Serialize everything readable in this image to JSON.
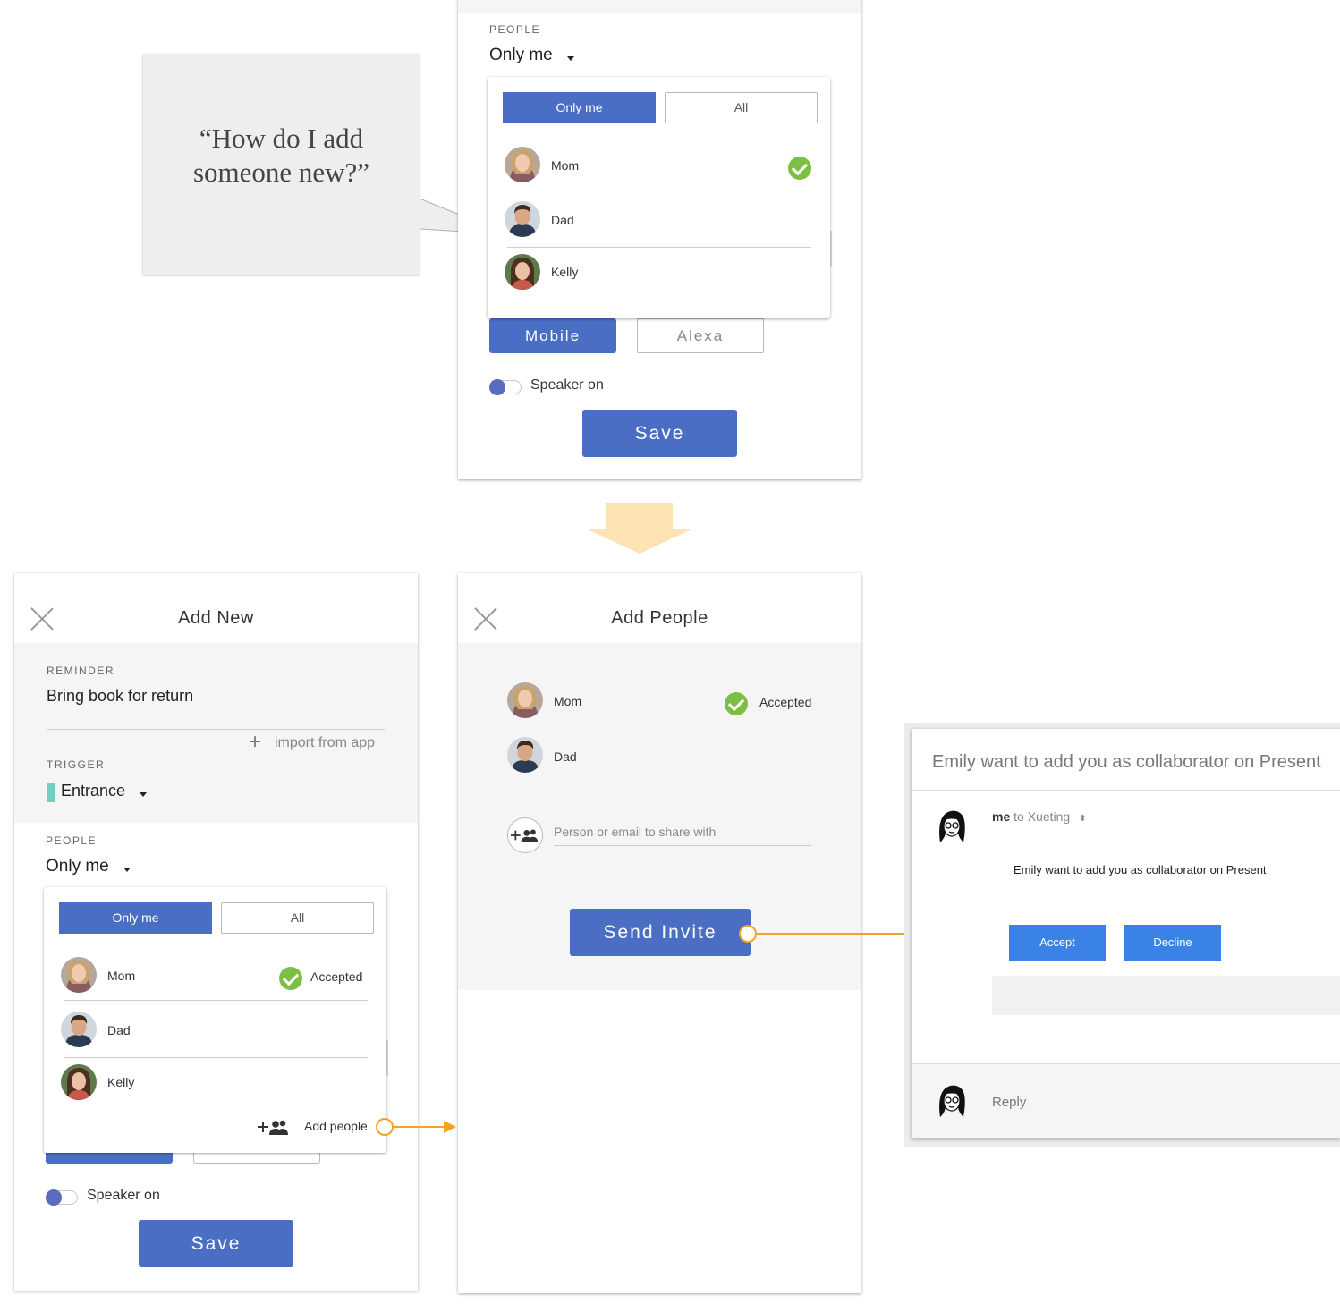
{
  "quote": {
    "line1": "“How do I add",
    "line2": "someone new?”"
  },
  "top_panel": {
    "people_label": "PEOPLE",
    "people_value": "Only me",
    "dropdown": {
      "only_me_tab": "Only me",
      "all_tab": "All",
      "persons": [
        {
          "name": "Mom",
          "checked": true
        },
        {
          "name": "Dad"
        },
        {
          "name": "Kelly"
        }
      ]
    },
    "mobile_button": "Mobile",
    "alexa_button": "Alexa",
    "speaker_label": "Speaker on",
    "save_button": "Save"
  },
  "add_new": {
    "title": "Add New",
    "reminder_label": "REMINDER",
    "reminder_value": "Bring book for return",
    "import_label": "import from app",
    "trigger_label": "TRIGGER",
    "trigger_value": "Entrance",
    "people_label": "PEOPLE",
    "people_value": "Only me",
    "dropdown": {
      "only_me_tab": "Only me",
      "all_tab": "All",
      "persons": [
        {
          "name": "Mom",
          "status": "Accepted"
        },
        {
          "name": "Dad"
        },
        {
          "name": "Kelly"
        }
      ],
      "add_people": "Add people"
    },
    "speaker_label": "Speaker on",
    "save_button": "Save"
  },
  "add_people": {
    "title": "Add People",
    "persons": [
      {
        "name": "Mom",
        "status": "Accepted"
      },
      {
        "name": "Dad"
      }
    ],
    "input_placeholder": "Person or email to share with",
    "send_button": "Send Invite"
  },
  "email": {
    "subject": "Emily want to add you as collaborator on Present",
    "from": "me",
    "to_text": "to Xueting",
    "body": "Emily want to add you as collaborator on Present",
    "accept": "Accept",
    "decline": "Decline",
    "reply": "Reply"
  },
  "colors": {
    "primary_blue": "#4a6ec4",
    "accent_orange": "#f0a425",
    "check_green": "#7bc043",
    "trigger_teal": "#6fd0c4"
  }
}
